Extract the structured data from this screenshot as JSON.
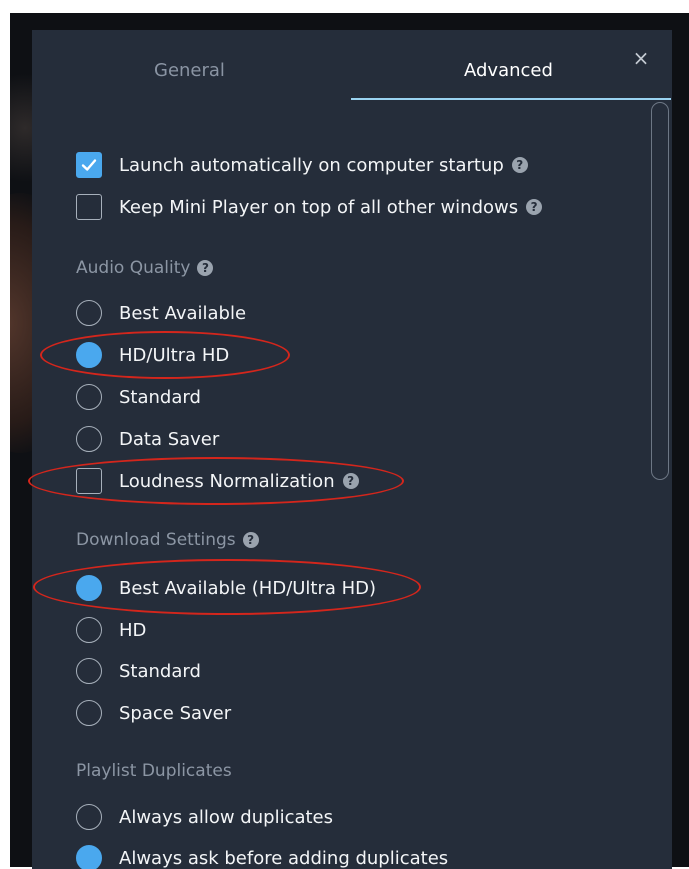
{
  "tabs": {
    "general": "General",
    "advanced": "Advanced",
    "close": "×"
  },
  "startup": {
    "launch": {
      "label": "Launch automatically on computer startup",
      "checked": true
    },
    "mini_player": {
      "label": "Keep Mini Player on top of all other windows",
      "checked": false
    }
  },
  "audio_quality": {
    "heading": "Audio Quality",
    "options": [
      "Best Available",
      "HD/Ultra HD",
      "Standard",
      "Data Saver"
    ],
    "selected": "HD/Ultra HD",
    "loudness": {
      "label": "Loudness Normalization",
      "checked": false
    }
  },
  "download_settings": {
    "heading": "Download Settings",
    "options": [
      "Best Available (HD/Ultra HD)",
      "HD",
      "Standard",
      "Space Saver"
    ],
    "selected": "Best Available (HD/Ultra HD)"
  },
  "playlist_duplicates": {
    "heading": "Playlist Duplicates",
    "options": [
      "Always allow duplicates",
      "Always ask before adding duplicates"
    ],
    "selected": "Always ask before adding duplicates"
  },
  "help_glyph": "?",
  "colors": {
    "panel": "#252d3a",
    "accent": "#4aa8ee",
    "tab_underline": "#9ad3f0",
    "annotation": "#d4261c"
  }
}
